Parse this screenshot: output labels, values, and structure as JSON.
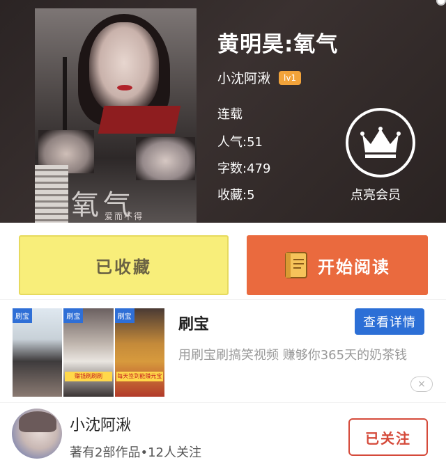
{
  "book": {
    "title": "黄明昊:氧气",
    "author": "小沈阿湫",
    "author_level": "lv1",
    "status": "连载",
    "popularity": "人气:51",
    "word_count": "字数:479",
    "favorites": "收藏:5",
    "cover_title": "氧气",
    "cover_subtitle": "爱而不得"
  },
  "vip": {
    "label": "点亮会员",
    "icon": "crown-icon"
  },
  "actions": {
    "favorited_label": "已收藏",
    "read_label": "开始阅读",
    "read_icon": "book-icon",
    "favorited_color": "#f8ee7a",
    "read_color": "#ea6a3e"
  },
  "ad": {
    "thumb_tag": "刷宝",
    "thumb_strip_2": "赚钱刷刷刷",
    "thumb_strip_3": "每天签到能赚元宝",
    "title": "刷宝",
    "detail_button": "查看详情",
    "description": "用刷宝刷搞笑视频  赚够你365天的奶茶钱",
    "close_icon": "close-icon",
    "close_glyph": "×",
    "accent": "#2c6fd6"
  },
  "author_card": {
    "name": "小沈阿湫",
    "info": "著有2部作品•12人关注",
    "follow_label": "已关注",
    "follow_color": "#d54a3a"
  }
}
